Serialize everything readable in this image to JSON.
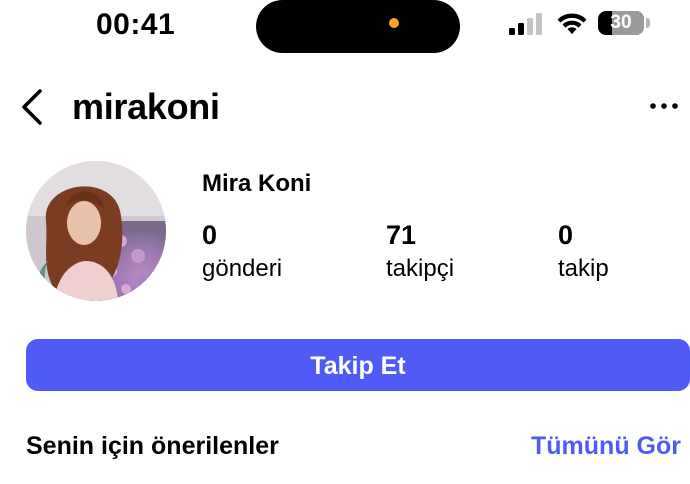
{
  "status_bar": {
    "time": "00:41",
    "battery_level": "30",
    "battery_fraction": 0.3,
    "island_dot_color": "#f5a623",
    "icons": [
      "cellular-signal-icon",
      "wifi-icon",
      "battery-icon"
    ]
  },
  "header": {
    "username": "mirakoni",
    "icons": [
      "back-chevron-icon",
      "more-options-icon"
    ]
  },
  "profile": {
    "display_name": "Mira Koni",
    "stats": [
      {
        "value": "0",
        "label": "gönderi"
      },
      {
        "value": "71",
        "label": "takipçi"
      },
      {
        "value": "0",
        "label": "takip"
      }
    ]
  },
  "actions": {
    "follow_label": "Takip Et",
    "accent_color": "#4f5bf4"
  },
  "suggestions": {
    "title": "Senin için önerilenler",
    "see_all_label": "Tümünü Gör"
  }
}
